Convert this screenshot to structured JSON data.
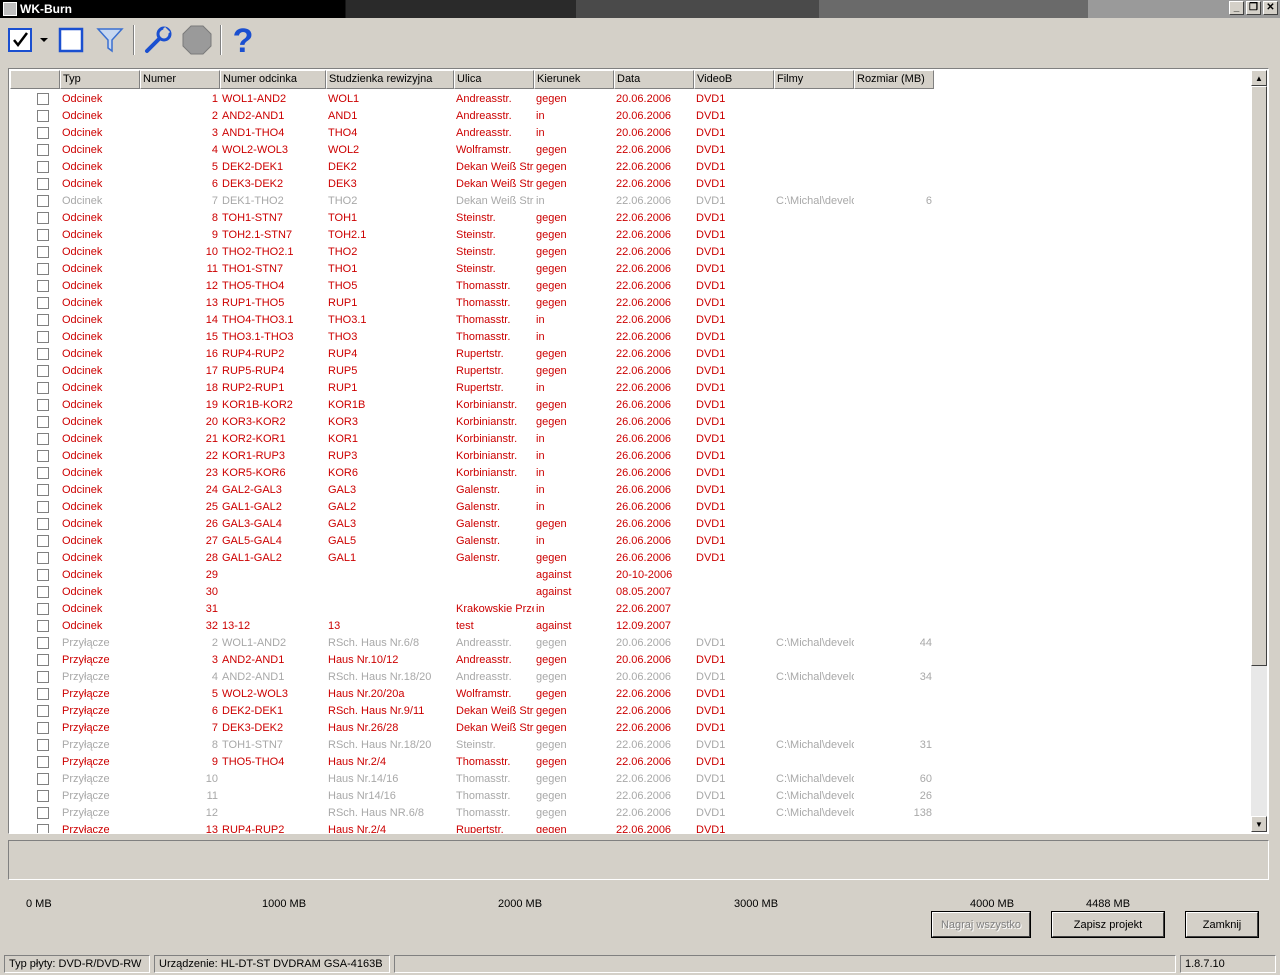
{
  "window": {
    "title": "WK-Burn",
    "min_label": "_",
    "restore_label": "❐",
    "close_label": "✕"
  },
  "toolbar": {
    "select_all_icon": "check-icon",
    "dropdown_icon": "chevron-down-icon",
    "deselect_icon": "square-icon",
    "filter_icon": "filter-icon",
    "settings_icon": "wrench-icon",
    "stop_icon": "stop-icon",
    "help_icon": "help-icon",
    "help_label": "?"
  },
  "table": {
    "columns": [
      "",
      "Typ",
      "Numer",
      "Numer odcinka",
      "Studzienka rewizyjna",
      "Ulica",
      "Kierunek",
      "Data",
      "VideoB",
      "Filmy",
      "Rozmiar (MB)"
    ],
    "rows": [
      {
        "checked": false,
        "on": true,
        "typ": "Odcinek",
        "num": "1",
        "odc": "WOL1-AND2",
        "stud": "WOL1",
        "ulica": "Andreasstr.",
        "kier": "gegen",
        "data": "20.06.2006",
        "vid": "DVD1",
        "film": "",
        "size": ""
      },
      {
        "checked": false,
        "on": true,
        "typ": "Odcinek",
        "num": "2",
        "odc": "AND2-AND1",
        "stud": "AND1",
        "ulica": "Andreasstr.",
        "kier": "in",
        "data": "20.06.2006",
        "vid": "DVD1",
        "film": "",
        "size": ""
      },
      {
        "checked": false,
        "on": true,
        "typ": "Odcinek",
        "num": "3",
        "odc": "AND1-THO4",
        "stud": "THO4",
        "ulica": "Andreasstr.",
        "kier": "in",
        "data": "20.06.2006",
        "vid": "DVD1",
        "film": "",
        "size": ""
      },
      {
        "checked": false,
        "on": true,
        "typ": "Odcinek",
        "num": "4",
        "odc": "WOL2-WOL3",
        "stud": "WOL2",
        "ulica": "Wolframstr.",
        "kier": "gegen",
        "data": "22.06.2006",
        "vid": "DVD1",
        "film": "",
        "size": ""
      },
      {
        "checked": false,
        "on": true,
        "typ": "Odcinek",
        "num": "5",
        "odc": "DEK2-DEK1",
        "stud": "DEK2",
        "ulica": "Dekan Weiß Str.",
        "kier": "gegen",
        "data": "22.06.2006",
        "vid": "DVD1",
        "film": "",
        "size": ""
      },
      {
        "checked": false,
        "on": true,
        "typ": "Odcinek",
        "num": "6",
        "odc": "DEK3-DEK2",
        "stud": "DEK3",
        "ulica": "Dekan Weiß Str.",
        "kier": "gegen",
        "data": "22.06.2006",
        "vid": "DVD1",
        "film": "",
        "size": ""
      },
      {
        "checked": false,
        "on": false,
        "typ": "Odcinek",
        "num": "7",
        "odc": "DEK1-THO2",
        "stud": "THO2",
        "ulica": "Dekan Weiß Str.",
        "kier": "in",
        "data": "22.06.2006",
        "vid": "DVD1",
        "film": "C:\\Michal\\develo",
        "size": "6"
      },
      {
        "checked": false,
        "on": true,
        "typ": "Odcinek",
        "num": "8",
        "odc": "TOH1-STN7",
        "stud": "TOH1",
        "ulica": "Steinstr.",
        "kier": "gegen",
        "data": "22.06.2006",
        "vid": "DVD1",
        "film": "",
        "size": ""
      },
      {
        "checked": false,
        "on": true,
        "typ": "Odcinek",
        "num": "9",
        "odc": "TOH2.1-STN7",
        "stud": "TOH2.1",
        "ulica": "Steinstr.",
        "kier": "gegen",
        "data": "22.06.2006",
        "vid": "DVD1",
        "film": "",
        "size": ""
      },
      {
        "checked": false,
        "on": true,
        "typ": "Odcinek",
        "num": "10",
        "odc": "THO2-THO2.1",
        "stud": "THO2",
        "ulica": "Steinstr.",
        "kier": "gegen",
        "data": "22.06.2006",
        "vid": "DVD1",
        "film": "",
        "size": ""
      },
      {
        "checked": false,
        "on": true,
        "typ": "Odcinek",
        "num": "11",
        "odc": "THO1-STN7",
        "stud": "THO1",
        "ulica": "Steinstr.",
        "kier": "gegen",
        "data": "22.06.2006",
        "vid": "DVD1",
        "film": "",
        "size": ""
      },
      {
        "checked": false,
        "on": true,
        "typ": "Odcinek",
        "num": "12",
        "odc": "THO5-THO4",
        "stud": "THO5",
        "ulica": "Thomasstr.",
        "kier": "gegen",
        "data": "22.06.2006",
        "vid": "DVD1",
        "film": "",
        "size": ""
      },
      {
        "checked": false,
        "on": true,
        "typ": "Odcinek",
        "num": "13",
        "odc": "RUP1-THO5",
        "stud": "RUP1",
        "ulica": "Thomasstr.",
        "kier": "gegen",
        "data": "22.06.2006",
        "vid": "DVD1",
        "film": "",
        "size": ""
      },
      {
        "checked": false,
        "on": true,
        "typ": "Odcinek",
        "num": "14",
        "odc": "THO4-THO3.1",
        "stud": "THO3.1",
        "ulica": "Thomasstr.",
        "kier": "in",
        "data": "22.06.2006",
        "vid": "DVD1",
        "film": "",
        "size": ""
      },
      {
        "checked": false,
        "on": true,
        "typ": "Odcinek",
        "num": "15",
        "odc": "THO3.1-THO3",
        "stud": "THO3",
        "ulica": "Thomasstr.",
        "kier": "in",
        "data": "22.06.2006",
        "vid": "DVD1",
        "film": "",
        "size": ""
      },
      {
        "checked": false,
        "on": true,
        "typ": "Odcinek",
        "num": "16",
        "odc": "RUP4-RUP2",
        "stud": "RUP4",
        "ulica": "Rupertstr.",
        "kier": "gegen",
        "data": "22.06.2006",
        "vid": "DVD1",
        "film": "",
        "size": ""
      },
      {
        "checked": false,
        "on": true,
        "typ": "Odcinek",
        "num": "17",
        "odc": "RUP5-RUP4",
        "stud": "RUP5",
        "ulica": "Rupertstr.",
        "kier": "gegen",
        "data": "22.06.2006",
        "vid": "DVD1",
        "film": "",
        "size": ""
      },
      {
        "checked": false,
        "on": true,
        "typ": "Odcinek",
        "num": "18",
        "odc": "RUP2-RUP1",
        "stud": "RUP1",
        "ulica": "Rupertstr.",
        "kier": "in",
        "data": "22.06.2006",
        "vid": "DVD1",
        "film": "",
        "size": ""
      },
      {
        "checked": false,
        "on": true,
        "typ": "Odcinek",
        "num": "19",
        "odc": "KOR1B-KOR2",
        "stud": "KOR1B",
        "ulica": "Korbinianstr.",
        "kier": "gegen",
        "data": "26.06.2006",
        "vid": "DVD1",
        "film": "",
        "size": ""
      },
      {
        "checked": false,
        "on": true,
        "typ": "Odcinek",
        "num": "20",
        "odc": "KOR3-KOR2",
        "stud": "KOR3",
        "ulica": "Korbinianstr.",
        "kier": "gegen",
        "data": "26.06.2006",
        "vid": "DVD1",
        "film": "",
        "size": ""
      },
      {
        "checked": false,
        "on": true,
        "typ": "Odcinek",
        "num": "21",
        "odc": "KOR2-KOR1",
        "stud": "KOR1",
        "ulica": "Korbinianstr.",
        "kier": "in",
        "data": "26.06.2006",
        "vid": "DVD1",
        "film": "",
        "size": ""
      },
      {
        "checked": false,
        "on": true,
        "typ": "Odcinek",
        "num": "22",
        "odc": "KOR1-RUP3",
        "stud": "RUP3",
        "ulica": "Korbinianstr.",
        "kier": "in",
        "data": "26.06.2006",
        "vid": "DVD1",
        "film": "",
        "size": ""
      },
      {
        "checked": false,
        "on": true,
        "typ": "Odcinek",
        "num": "23",
        "odc": "KOR5-KOR6",
        "stud": "KOR6",
        "ulica": "Korbinianstr.",
        "kier": "in",
        "data": "26.06.2006",
        "vid": "DVD1",
        "film": "",
        "size": ""
      },
      {
        "checked": false,
        "on": true,
        "typ": "Odcinek",
        "num": "24",
        "odc": "GAL2-GAL3",
        "stud": "GAL3",
        "ulica": "Galenstr.",
        "kier": "in",
        "data": "26.06.2006",
        "vid": "DVD1",
        "film": "",
        "size": ""
      },
      {
        "checked": false,
        "on": true,
        "typ": "Odcinek",
        "num": "25",
        "odc": "GAL1-GAL2",
        "stud": "GAL2",
        "ulica": "Galenstr.",
        "kier": "in",
        "data": "26.06.2006",
        "vid": "DVD1",
        "film": "",
        "size": ""
      },
      {
        "checked": false,
        "on": true,
        "typ": "Odcinek",
        "num": "26",
        "odc": "GAL3-GAL4",
        "stud": "GAL3",
        "ulica": "Galenstr.",
        "kier": "gegen",
        "data": "26.06.2006",
        "vid": "DVD1",
        "film": "",
        "size": ""
      },
      {
        "checked": false,
        "on": true,
        "typ": "Odcinek",
        "num": "27",
        "odc": "GAL5-GAL4",
        "stud": "GAL5",
        "ulica": "Galenstr.",
        "kier": "in",
        "data": "26.06.2006",
        "vid": "DVD1",
        "film": "",
        "size": ""
      },
      {
        "checked": false,
        "on": true,
        "typ": "Odcinek",
        "num": "28",
        "odc": "GAL1-GAL2",
        "stud": "GAL1",
        "ulica": "Galenstr.",
        "kier": "gegen",
        "data": "26.06.2006",
        "vid": "DVD1",
        "film": "",
        "size": ""
      },
      {
        "checked": false,
        "on": true,
        "typ": "Odcinek",
        "num": "29",
        "odc": "",
        "stud": "",
        "ulica": "",
        "kier": "against",
        "data": "20-10-2006",
        "vid": "",
        "film": "",
        "size": ""
      },
      {
        "checked": false,
        "on": true,
        "typ": "Odcinek",
        "num": "30",
        "odc": "",
        "stud": "",
        "ulica": "",
        "kier": "against",
        "data": "08.05.2007",
        "vid": "",
        "film": "",
        "size": ""
      },
      {
        "checked": false,
        "on": true,
        "typ": "Odcinek",
        "num": "31",
        "odc": "",
        "stud": "",
        "ulica": "Krakowskie Prze",
        "kier": "in",
        "data": "22.06.2007",
        "vid": "",
        "film": "",
        "size": ""
      },
      {
        "checked": false,
        "on": true,
        "typ": "Odcinek",
        "num": "32",
        "odc": "13-12",
        "stud": "13",
        "ulica": "test",
        "kier": "against",
        "data": "12.09.2007",
        "vid": "",
        "film": "",
        "size": ""
      },
      {
        "checked": false,
        "on": false,
        "typ": "Przyłącze",
        "num": "2",
        "odc": "WOL1-AND2",
        "stud": "RSch. Haus Nr.6/8",
        "ulica": "Andreasstr.",
        "kier": "gegen",
        "data": "20.06.2006",
        "vid": "DVD1",
        "film": "C:\\Michal\\develo",
        "size": "44"
      },
      {
        "checked": false,
        "on": true,
        "typ": "Przyłącze",
        "num": "3",
        "odc": "AND2-AND1",
        "stud": "Haus Nr.10/12",
        "ulica": "Andreasstr.",
        "kier": "gegen",
        "data": "20.06.2006",
        "vid": "DVD1",
        "film": "",
        "size": ""
      },
      {
        "checked": false,
        "on": false,
        "typ": "Przyłącze",
        "num": "4",
        "odc": "AND2-AND1",
        "stud": "RSch. Haus Nr.18/20",
        "ulica": "Andreasstr.",
        "kier": "gegen",
        "data": "20.06.2006",
        "vid": "DVD1",
        "film": "C:\\Michal\\develo",
        "size": "34"
      },
      {
        "checked": false,
        "on": true,
        "typ": "Przyłącze",
        "num": "5",
        "odc": "WOL2-WOL3",
        "stud": "Haus Nr.20/20a",
        "ulica": "Wolframstr.",
        "kier": "gegen",
        "data": "22.06.2006",
        "vid": "DVD1",
        "film": "",
        "size": ""
      },
      {
        "checked": false,
        "on": true,
        "typ": "Przyłącze",
        "num": "6",
        "odc": "DEK2-DEK1",
        "stud": "RSch. Haus Nr.9/11",
        "ulica": "Dekan Weiß Str.",
        "kier": "gegen",
        "data": "22.06.2006",
        "vid": "DVD1",
        "film": "",
        "size": ""
      },
      {
        "checked": false,
        "on": true,
        "typ": "Przyłącze",
        "num": "7",
        "odc": "DEK3-DEK2",
        "stud": "Haus Nr.26/28",
        "ulica": "Dekan Weiß Str.",
        "kier": "gegen",
        "data": "22.06.2006",
        "vid": "DVD1",
        "film": "",
        "size": ""
      },
      {
        "checked": false,
        "on": false,
        "typ": "Przyłącze",
        "num": "8",
        "odc": "TOH1-STN7",
        "stud": "RSch. Haus Nr.18/20",
        "ulica": "Steinstr.",
        "kier": "gegen",
        "data": "22.06.2006",
        "vid": "DVD1",
        "film": "C:\\Michal\\develo",
        "size": "31"
      },
      {
        "checked": false,
        "on": true,
        "typ": "Przyłącze",
        "num": "9",
        "odc": "THO5-THO4",
        "stud": "Haus Nr.2/4",
        "ulica": "Thomasstr.",
        "kier": "gegen",
        "data": "22.06.2006",
        "vid": "DVD1",
        "film": "",
        "size": ""
      },
      {
        "checked": false,
        "on": false,
        "typ": "Przyłącze",
        "num": "10",
        "odc": "",
        "stud": "Haus Nr.14/16",
        "ulica": "Thomasstr.",
        "kier": "gegen",
        "data": "22.06.2006",
        "vid": "DVD1",
        "film": "C:\\Michal\\develo",
        "size": "60"
      },
      {
        "checked": false,
        "on": false,
        "typ": "Przyłącze",
        "num": "11",
        "odc": "",
        "stud": "Haus Nr14/16",
        "ulica": "Thomasstr.",
        "kier": "gegen",
        "data": "22.06.2006",
        "vid": "DVD1",
        "film": "C:\\Michal\\develo",
        "size": "26"
      },
      {
        "checked": false,
        "on": false,
        "typ": "Przyłącze",
        "num": "12",
        "odc": "",
        "stud": "RSch. Haus NR.6/8",
        "ulica": "Thomasstr.",
        "kier": "gegen",
        "data": "22.06.2006",
        "vid": "DVD1",
        "film": "C:\\Michal\\develo",
        "size": "138"
      },
      {
        "checked": false,
        "on": true,
        "typ": "Przyłącze",
        "num": "13",
        "odc": "RUP4-RUP2",
        "stud": "Haus Nr.2/4",
        "ulica": "Rupertstr.",
        "kier": "gegen",
        "data": "22.06.2006",
        "vid": "DVD1",
        "film": "",
        "size": ""
      }
    ]
  },
  "capacity": {
    "labels": [
      "0 MB",
      "1000 MB",
      "2000 MB",
      "3000 MB",
      "4000 MB",
      "4488 MB"
    ]
  },
  "buttons": {
    "burn_all": "Nagraj wszystko",
    "save_project": "Zapisz projekt",
    "close": "Zamknij"
  },
  "status": {
    "disc_type": "Typ płyty: DVD-R/DVD-RW",
    "device": "Urządzenie: HL-DT-ST DVDRAM GSA-4163B",
    "empty": "",
    "version": "1.8.7.10"
  },
  "colors": {
    "active_row": "#cc0000",
    "inactive_row": "#a8a8a8",
    "toolbar_blue": "#1a4fd0"
  }
}
